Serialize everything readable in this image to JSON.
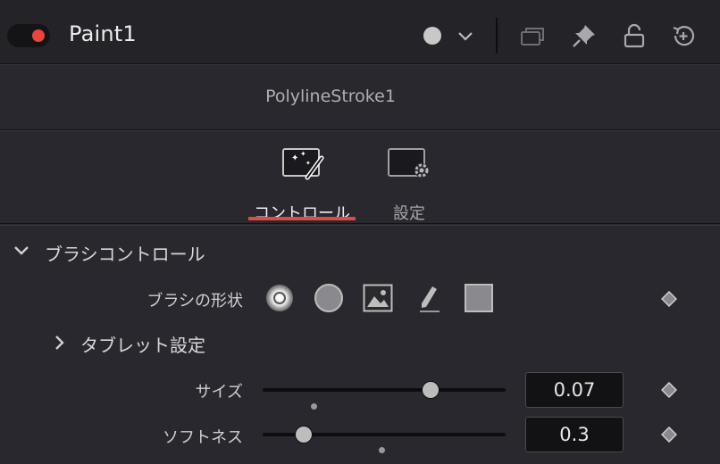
{
  "header": {
    "node_title": "Paint1",
    "enabled": true,
    "colors": {
      "enabled_dot": "#e8453c",
      "tab_underline": "#e04a42"
    },
    "icons": [
      "color-circle-icon",
      "chevron-down-icon",
      "versions-icon",
      "pin-icon",
      "lock-icon",
      "reset-icon"
    ]
  },
  "node_bar": {
    "name": "PolylineStroke1"
  },
  "tabs": [
    {
      "label": "コントロール",
      "icon": "magic-wand-icon",
      "active": true
    },
    {
      "label": "設定",
      "icon": "settings-screen-icon",
      "active": false
    }
  ],
  "section": {
    "title": "ブラシコントロール",
    "expanded": true,
    "brush_shape": {
      "label": "ブラシの形状",
      "options": [
        "soft-brush-icon",
        "circle-brush-icon",
        "image-brush-icon",
        "single-pixel-brush-icon",
        "square-brush-icon"
      ],
      "selected": 0
    },
    "tablet": {
      "title": "タブレット設定",
      "expanded": false
    },
    "size": {
      "label": "サイズ",
      "value": "0.07",
      "slider_fraction": 0.69,
      "default_fraction": 0.21
    },
    "softness": {
      "label": "ソフトネス",
      "value": "0.3",
      "slider_fraction": 0.17,
      "default_fraction": 0.49
    }
  }
}
